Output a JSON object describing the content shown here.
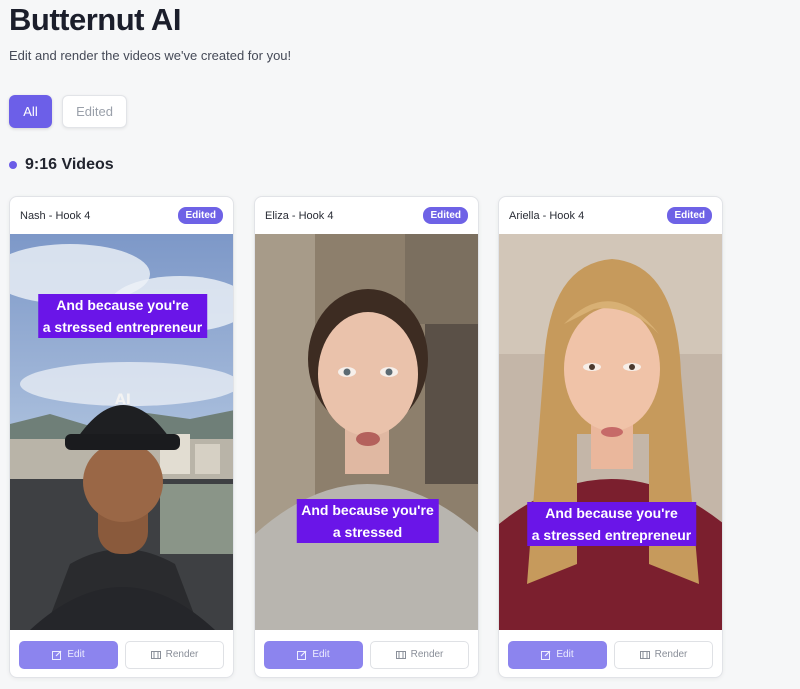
{
  "app": {
    "title": "Butternut AI",
    "subtitle": "Edit and render the videos we've created for you!"
  },
  "filters": {
    "all_label": "All",
    "edited_label": "Edited"
  },
  "section": {
    "title": "9:16 Videos"
  },
  "colors": {
    "accent": "#6c5fe8",
    "caption_bg": "#6a15e8"
  },
  "cards": [
    {
      "name": "Nash - Hook 4",
      "badge": "Edited",
      "caption_line1": "And because you're",
      "caption_line2": "a stressed entrepreneur",
      "edit_label": "Edit",
      "render_label": "Render"
    },
    {
      "name": "Eliza - Hook 4",
      "badge": "Edited",
      "caption_line1": "And because you're",
      "caption_line2": "a stressed",
      "edit_label": "Edit",
      "render_label": "Render"
    },
    {
      "name": "Ariella - Hook 4",
      "badge": "Edited",
      "caption_line1": "And because you're",
      "caption_line2": "a stressed entrepreneur",
      "edit_label": "Edit",
      "render_label": "Render"
    }
  ],
  "icons": {
    "edit": "pencil-square-icon",
    "render": "film-icon",
    "cap_logo": "AI"
  }
}
